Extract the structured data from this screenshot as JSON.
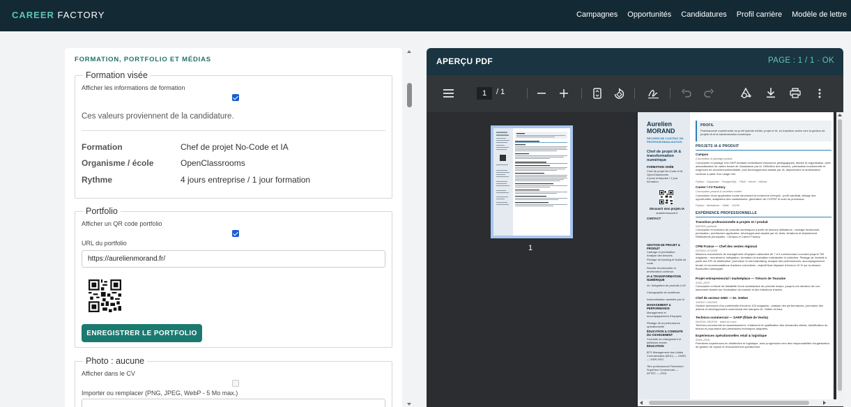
{
  "brand": {
    "accent": "CAREER",
    "rest": "FACTORY"
  },
  "nav": [
    "Campagnes",
    "Opportunités",
    "Candidatures",
    "Profil carrière",
    "Modèle de lettre"
  ],
  "left": {
    "section_title": "FORMATION, PORTFOLIO ET MÉDIAS",
    "formation": {
      "legend": "Formation visée",
      "show_label": "Afficher les informations de formation",
      "show_checked": true,
      "note": "Ces valeurs proviennent de la candidature.",
      "rows": [
        {
          "key": "Formation",
          "value": "Chef de projet No-Code et IA"
        },
        {
          "key": "Organisme / école",
          "value": "OpenClassrooms"
        },
        {
          "key": "Rythme",
          "value": "4 jours entreprise / 1 jour formation"
        }
      ]
    },
    "portfolio": {
      "legend": "Portfolio",
      "qr_label": "Afficher un QR code portfolio",
      "qr_checked": true,
      "url_label": "URL du portfolio",
      "url_value": "https://aurelienmorand.fr/",
      "save_button": "ENREGISTRER LE PORTFOLIO"
    },
    "photo": {
      "legend": "Photo : aucune",
      "show_label": "Afficher dans le CV",
      "show_checked": false,
      "import_label": "Importer ou remplacer (PNG, JPEG, WebP - 5 Mo max.)"
    }
  },
  "right": {
    "title": "APERÇU PDF",
    "page_status": "PAGE : 1 / 1 · OK",
    "toolbar": {
      "current_page": "1",
      "total_pages": "1"
    },
    "thumb_number": "1",
    "cv": {
      "first_name": "Aurelien",
      "last_name": "MORAND",
      "subtitle": "RECHERCHE CONTRAT EN PROFESSIONNALISATION",
      "job_title": "Chef de projet IA & transformation numérique",
      "formation_title": "FORMATION VISÉE",
      "formation_lines": [
        "Chef de projet No-Code et IA",
        "OpenClassrooms",
        "4 jours entreprise / 1 jour formation"
      ],
      "qr_caption": "Découvrir mon projets IA",
      "qr_url": "aurelienmorand.fr",
      "contact_title": "CONTACT",
      "competences": [
        {
          "title": "GESTION DE PROJET & PRODUIT",
          "items": [
            "Cadrage et priorisation",
            "Analyse des besoins",
            "Pilotage de backlog et feuille de route",
            "Recette fonctionnelle et amélioration continue"
          ]
        },
        {
          "title": "IA & TRANSFORMATION NUMÉRIQUE",
          "items": [
            "IA / Intégration de produits LLM",
            "Cartographie de workflows",
            "Automatisation assistée par IA"
          ]
        },
        {
          "title": "MANAGEMENT & PERFORMANCE",
          "items": [
            "Management et accompagnement d'équipes",
            "Pilotage de la performance opérationnelle"
          ]
        },
        {
          "title": "ÉDUCATION & CONDUITE DU CHANGEMENT",
          "items": [
            "Conduite du changement et adhésion terrain"
          ]
        },
        {
          "title": "ÉDUCATION",
          "items": [
            "BTS Management des Unités Commerciales (MUC) — CNED — 2009-2012",
            "Titre professionnel Technicien Supérieur Commercial — AFTEC — 2016"
          ]
        }
      ],
      "profil_title": "PROFIL",
      "profil_text": "Professionnel expérimenté au profil hybride métier, projet et IA, en transition active vers la gestion de projets IA et la transformation numérique.",
      "projects_title": "PROJETS IA & PRODUIT",
      "projects": [
        {
          "name": "Campus",
          "sub": "Conception & pilotage produit",
          "desc": "Conception et pilotage d'un MVP étudiant centralisant ressources pédagogiques, tâches et organisation, avec automatisation de cartes issues de l'assistance par IA. Définition des besoins, priorisation fonctionnelle et exigences de sécurité/confidentialité, plus développement assisté par IA, déploiement et amélioration continue à partir d'un usage réel.",
          "tags": "Python · Supabase · PostgreSQL · PWA · Vercel · GitHub"
        },
        {
          "name": "Career / CV Factory",
          "sub": "Conception produit & workflow métier",
          "desc": "Conception d'une application locale structurant la recherche d'emploi : profil candidat, ciblage des opportunités, adaptation des candidatures, génération de CV/PDF et suivi du processus.",
          "tags": "Python · Markdown · YAML · JSON"
        }
      ],
      "experience_title": "EXPÉRIENCE PROFESSIONNELLE",
      "experiences": [
        {
          "role": "Transition professionnelle & projets IA / produit",
          "date": "09/2025–présent",
          "desc": "Conception et évolution de produits numériques à partir de besoins utilisateurs : cadrage fonctionnel, priorisation, architecture applicative, développement assisté par IA, tests, itérations et déploiement. Réalisations principales : Campus et Career Factory."
        },
        {
          "role": "CPM France — Chef des ventes régional",
          "date": "03/2020–07/2025",
          "desc": "Missions successives de management d'équipes nationales de 7 à 9 commerciaux couvrant jusqu'à 750 magasins : recrutement, intégration, formation et animation individuelle et collective. Pilotage de l'activité à partir des KPI de distribution, promotion et merchandising, analyse des performances, accompagnement terrain et recommandations d'actions correctives ; objectif final dépassé d'environ 10 % sur la mission Bonduelle-Cassegrain."
        },
        {
          "role": "Projet entrepreneurial / marketplace — Trésors de Touraine",
          "date": "2022–2023",
          "desc": "Conception et étude de faisabilité d'une marketplace de produits locaux, jusqu'à une décision de non-lancement fondée sur l'évaluation du marché et des intentions d'achat."
        },
        {
          "role": "Chef de secteur GMS — Dr. Oetker",
          "date": "10/2017–03/2022",
          "desc": "Gestion autonome d'un portefeuille d'environ 100 magasins : analyse des performances, promotion des actions et développement commercial des marques Dr. Oetker et Alsa."
        },
        {
          "role": "Technico-commercial — SARP (filiale de Veolia)",
          "date": "06/2016–09/2016 · Indre-et-Loire",
          "desc": "Technico-commercial en assainissement : traitement et qualification des demandes clients, identification du besoin et proposition des prestations techniques adaptées."
        },
        {
          "role": "Expériences opérationnelles retail & logistique",
          "date": "2009–2016",
          "desc": "Premières expériences en distribution et logistique, avec progression vers des responsabilités d'organisation, de gestion de rayons et d'encadrement opérationnel."
        }
      ]
    }
  }
}
